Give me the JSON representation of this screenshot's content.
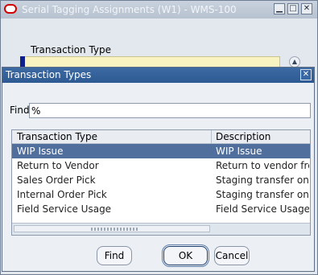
{
  "background_window": {
    "title": "Serial Tagging Assignments (W1) - WMS-100",
    "field_label": "Transaction Type",
    "controls": [
      "minimize",
      "maximize",
      "close"
    ]
  },
  "dialog": {
    "title": "Transaction Types",
    "find_label": "Find",
    "find_value": "%",
    "columns": [
      "Transaction Type",
      "Description"
    ],
    "rows": [
      {
        "type": "WIP Issue",
        "description": "WIP Issue",
        "selected": true
      },
      {
        "type": "Return to Vendor",
        "description": "Return to vendor from",
        "selected": false
      },
      {
        "type": "Sales Order Pick",
        "description": "Staging transfer on a S",
        "selected": false
      },
      {
        "type": "Internal Order Pick",
        "description": "Staging transfer on an",
        "selected": false
      },
      {
        "type": "Field Service Usage",
        "description": "Field Service Usage",
        "selected": false
      }
    ],
    "buttons": {
      "find": "Find",
      "ok": "OK",
      "cancel": "Cancel"
    }
  },
  "colors": {
    "dialog_title": "#2e5a93",
    "selection": "#516f9c",
    "field_yellow": "#f9f3c1",
    "oracle_red": "#d30000"
  },
  "icons": {
    "app_logo": "oracle-logo-icon",
    "minimize": "minimize-icon",
    "maximize": "maximize-icon",
    "close": "close-icon",
    "scroll_up": "scroll-up-icon"
  }
}
